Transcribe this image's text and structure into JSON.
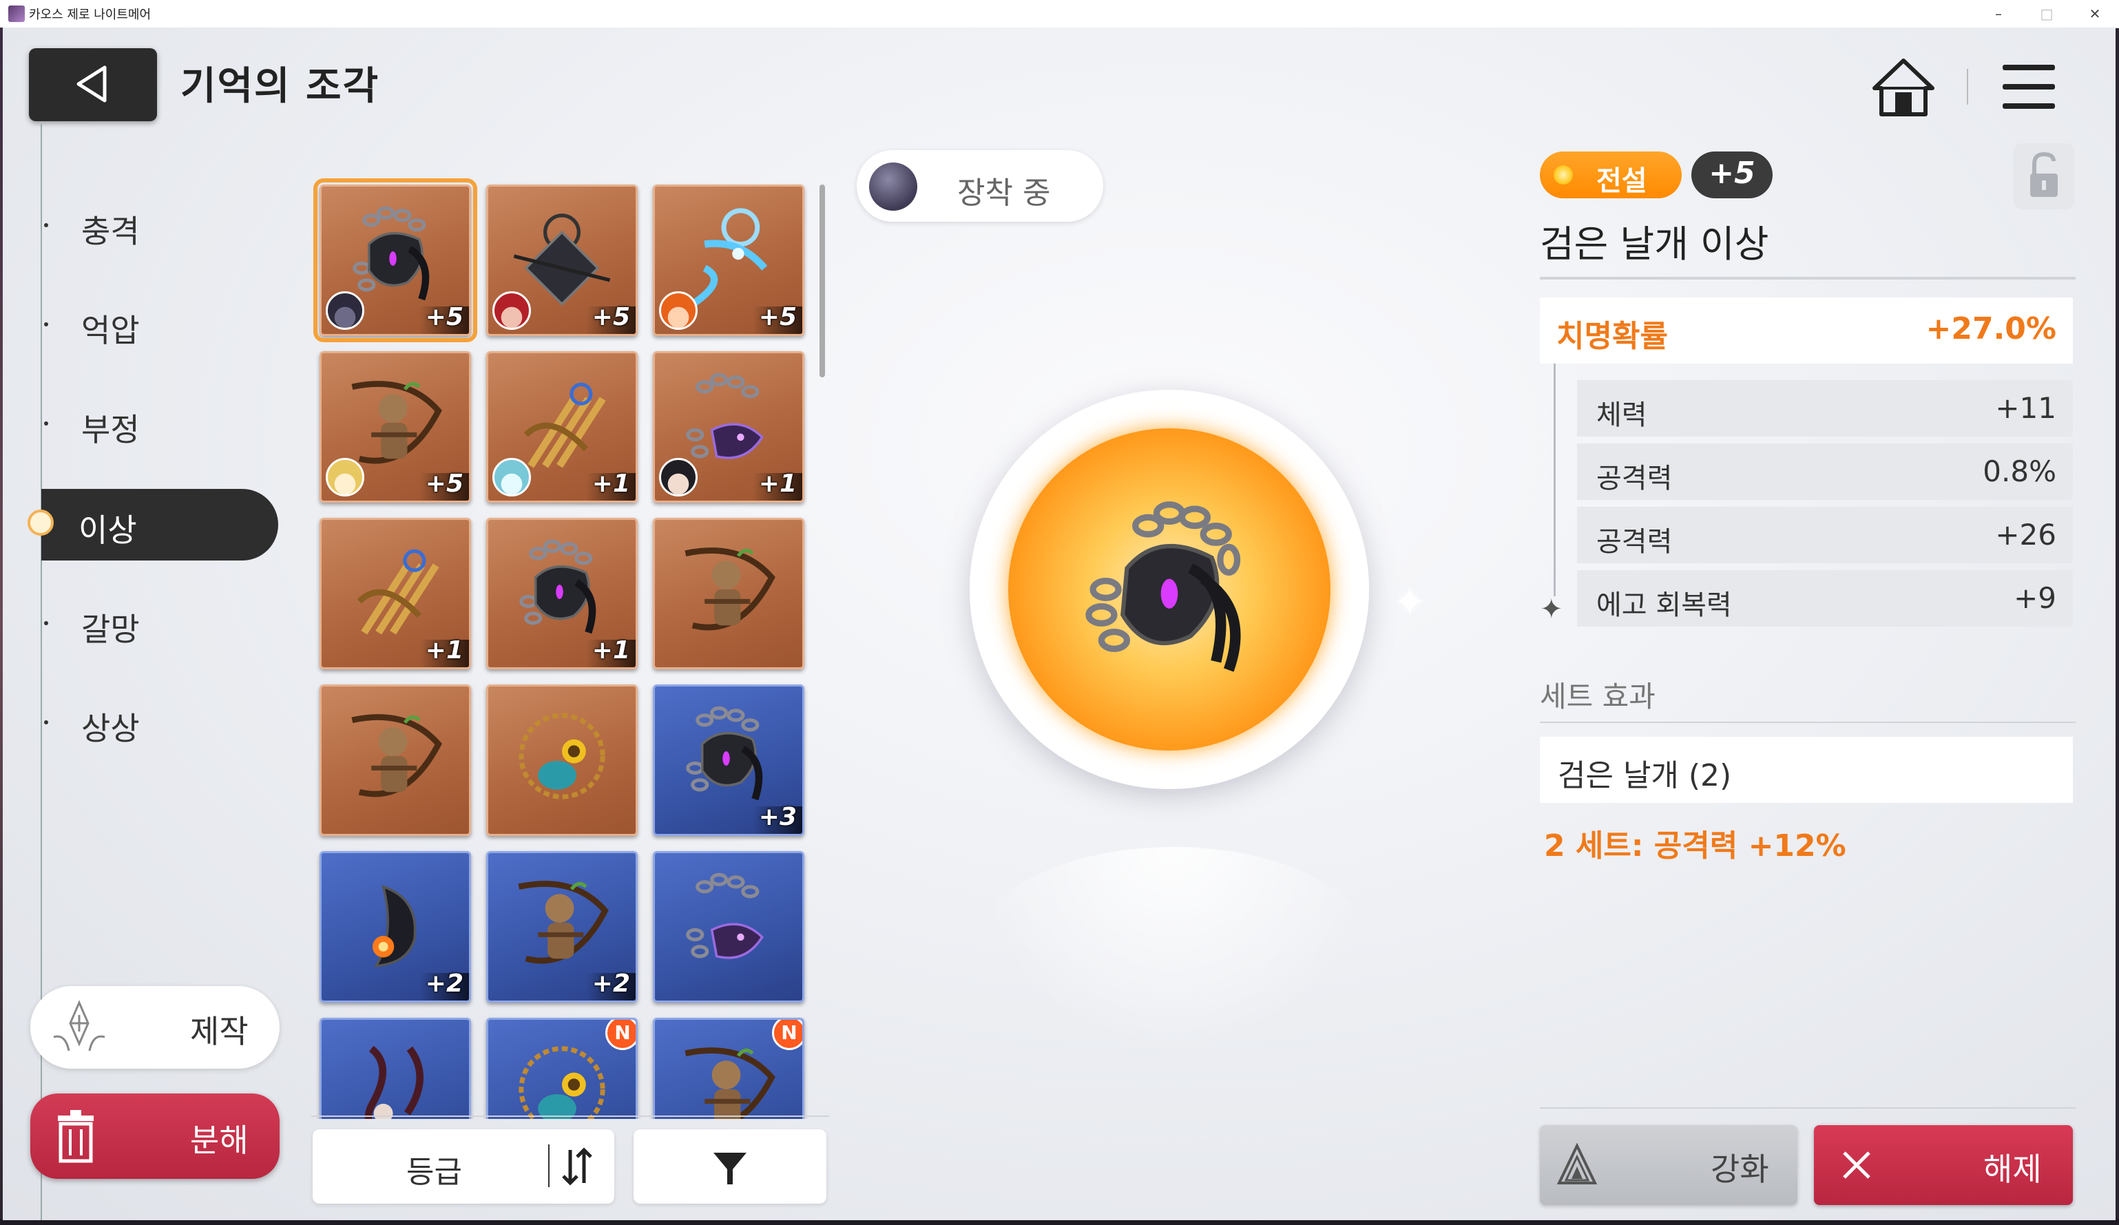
{
  "window": {
    "title": "카오스 제로 나이트메어"
  },
  "header": {
    "title": "기억의 조각"
  },
  "categories": [
    {
      "label": "충격",
      "active": false
    },
    {
      "label": "억압",
      "active": false
    },
    {
      "label": "부정",
      "active": false
    },
    {
      "label": "이상",
      "active": true
    },
    {
      "label": "갈망",
      "active": false
    },
    {
      "label": "상상",
      "active": false
    }
  ],
  "actions": {
    "craft_label": "제작",
    "dismantle_label": "분해"
  },
  "grid": {
    "tiles": [
      {
        "frame": "bronze",
        "art": "black-wing-amulet-icon",
        "level": "+5",
        "avatar": "dark-ally",
        "selected": true,
        "new": false
      },
      {
        "frame": "bronze",
        "art": "spiked-dark-charm-icon",
        "level": "+5",
        "avatar": "red-hair",
        "selected": false,
        "new": false
      },
      {
        "frame": "bronze",
        "art": "ice-wing-charm-icon",
        "level": "+5",
        "avatar": "orange-hair",
        "selected": false,
        "new": false
      },
      {
        "frame": "bronze",
        "art": "straw-doll-charm-icon",
        "level": "+5",
        "avatar": "blonde",
        "selected": false,
        "new": false
      },
      {
        "frame": "bronze",
        "art": "golden-trident-charm-icon",
        "level": "+1",
        "avatar": "teal-hair",
        "selected": false,
        "new": false
      },
      {
        "frame": "bronze",
        "art": "purple-dragon-chain-icon",
        "level": "+1",
        "avatar": "black-hair",
        "selected": false,
        "new": false
      },
      {
        "frame": "bronze",
        "art": "golden-trident-charm-icon",
        "level": "+1",
        "avatar": "",
        "selected": false,
        "new": false
      },
      {
        "frame": "bronze",
        "art": "black-wing-amulet-icon",
        "level": "+1",
        "avatar": "",
        "selected": false,
        "new": false
      },
      {
        "frame": "bronze",
        "art": "straw-doll-charm-icon",
        "level": "",
        "avatar": "",
        "selected": false,
        "new": false
      },
      {
        "frame": "bronze",
        "art": "straw-doll-charm-icon",
        "level": "",
        "avatar": "",
        "selected": false,
        "new": false
      },
      {
        "frame": "bronze",
        "art": "sunflower-scarab-amulet-icon",
        "level": "",
        "avatar": "",
        "selected": false,
        "new": false
      },
      {
        "frame": "blue",
        "art": "black-wing-amulet-icon",
        "level": "+3",
        "avatar": "",
        "selected": false,
        "new": false
      },
      {
        "frame": "blue",
        "art": "flame-gem-feather-icon",
        "level": "+2",
        "avatar": "",
        "selected": false,
        "new": false
      },
      {
        "frame": "blue",
        "art": "straw-doll-charm-icon",
        "level": "+2",
        "avatar": "",
        "selected": false,
        "new": false
      },
      {
        "frame": "blue",
        "art": "purple-dragon-chain-icon",
        "level": "",
        "avatar": "",
        "selected": false,
        "new": false
      },
      {
        "frame": "blue",
        "art": "ribbon-charm-icon",
        "level": "",
        "avatar": "",
        "selected": false,
        "new": false
      },
      {
        "frame": "blue",
        "art": "sunflower-scarab-amulet-icon",
        "level": "",
        "avatar": "",
        "selected": false,
        "new": true
      },
      {
        "frame": "blue",
        "art": "straw-doll-charm-icon",
        "level": "",
        "avatar": "",
        "selected": false,
        "new": true
      }
    ],
    "new_badge": "N"
  },
  "sort": {
    "label": "등급"
  },
  "equipped": {
    "label": "장착 중"
  },
  "item": {
    "rarity": "전설",
    "level": "+5",
    "name": "검은 날개 이상",
    "main_stat": {
      "name": "치명확률",
      "value": "+27.0%"
    },
    "sub_stats": [
      {
        "name": "체력",
        "value": "+11"
      },
      {
        "name": "공격력",
        "value": "0.8%"
      },
      {
        "name": "공격력",
        "value": "+26"
      },
      {
        "name": "에고 회복력",
        "value": "+9"
      }
    ],
    "set_title": "세트 효과",
    "set_name": "검은 날개 (2)",
    "set_effect": "2 세트: 공격력 +12%"
  },
  "buttons": {
    "enhance_label": "강화",
    "release_label": "해제"
  },
  "colors": {
    "accent_orange": "#f07a1a",
    "rarity_orange": "#ff8a00",
    "danger_red": "#c82e49",
    "dark": "#2e2e2e"
  }
}
